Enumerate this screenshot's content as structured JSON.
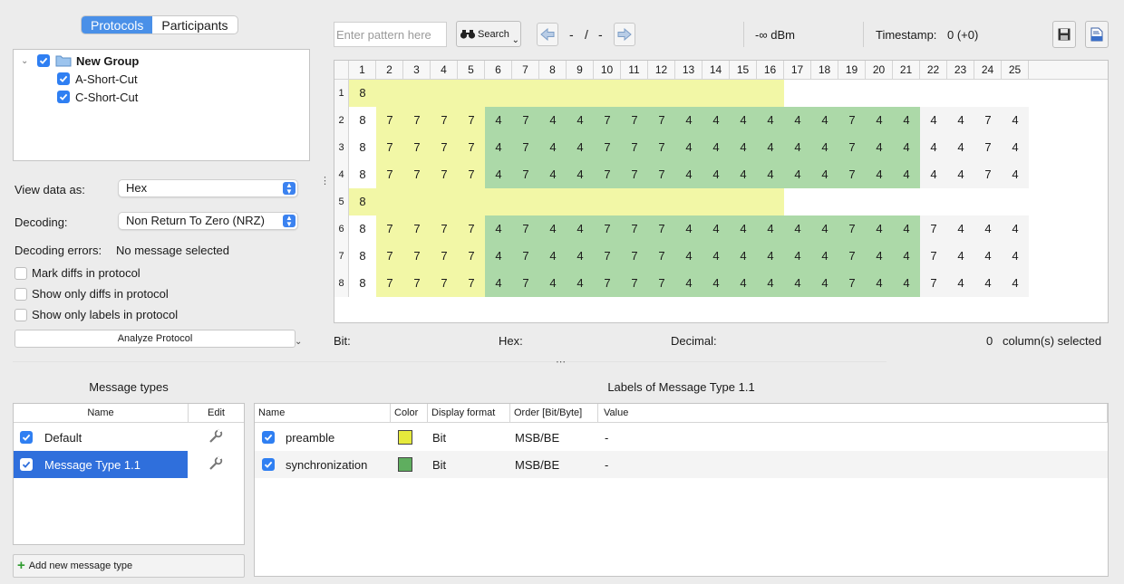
{
  "tabs": [
    {
      "label": "Protocols",
      "active": true
    },
    {
      "label": "Participants",
      "active": false
    }
  ],
  "tree": {
    "group": {
      "label": "New Group",
      "checked": true
    },
    "items": [
      {
        "label": "A-Short-Cut",
        "checked": true
      },
      {
        "label": "C-Short-Cut",
        "checked": true
      }
    ]
  },
  "settings": {
    "view_label": "View data as:",
    "view_value": "Hex",
    "decoding_label": "Decoding:",
    "decoding_value": "Non Return To Zero (NRZ)",
    "errors_label": "Decoding errors:",
    "errors_value": "No message selected",
    "options": [
      {
        "label": "Mark diffs in protocol",
        "checked": false
      },
      {
        "label": "Show only diffs in protocol",
        "checked": false
      },
      {
        "label": "Show only labels in protocol",
        "checked": false
      }
    ],
    "analyze_label": "Analyze Protocol"
  },
  "toolbar": {
    "search_placeholder": "Enter pattern here",
    "search_label": "Search",
    "result_index": "-",
    "result_sep": "/",
    "result_total": "-",
    "rssi": "-∞ dBm",
    "timestamp_label": "Timestamp:",
    "timestamp_value": "0 (+0)"
  },
  "protocol_table": {
    "columns": [
      "1",
      "2",
      "3",
      "4",
      "5",
      "6",
      "7",
      "8",
      "9",
      "10",
      "11",
      "12",
      "13",
      "14",
      "15",
      "16",
      "17",
      "18",
      "19",
      "20",
      "21",
      "22",
      "23",
      "24",
      "25"
    ],
    "rows": [
      {
        "label": "1",
        "cells": [
          "8"
        ]
      },
      {
        "label": "2",
        "cells": [
          "8",
          "7",
          "7",
          "7",
          "7",
          "4",
          "7",
          "4",
          "4",
          "7",
          "7",
          "7",
          "4",
          "4",
          "4",
          "4",
          "4",
          "4",
          "7",
          "4",
          "4",
          "4",
          "4",
          "7",
          "4"
        ]
      },
      {
        "label": "3",
        "cells": [
          "8",
          "7",
          "7",
          "7",
          "7",
          "4",
          "7",
          "4",
          "4",
          "7",
          "7",
          "7",
          "4",
          "4",
          "4",
          "4",
          "4",
          "4",
          "7",
          "4",
          "4",
          "4",
          "4",
          "7",
          "4"
        ]
      },
      {
        "label": "4",
        "cells": [
          "8",
          "7",
          "7",
          "7",
          "7",
          "4",
          "7",
          "4",
          "4",
          "7",
          "7",
          "7",
          "4",
          "4",
          "4",
          "4",
          "4",
          "4",
          "7",
          "4",
          "4",
          "4",
          "4",
          "7",
          "4"
        ]
      },
      {
        "label": "5",
        "cells": [
          "8"
        ]
      },
      {
        "label": "6",
        "cells": [
          "8",
          "7",
          "7",
          "7",
          "7",
          "4",
          "7",
          "4",
          "4",
          "7",
          "7",
          "7",
          "4",
          "4",
          "4",
          "4",
          "4",
          "4",
          "7",
          "4",
          "4",
          "7",
          "4",
          "4",
          "4"
        ]
      },
      {
        "label": "7",
        "cells": [
          "8",
          "7",
          "7",
          "7",
          "7",
          "4",
          "7",
          "4",
          "4",
          "7",
          "7",
          "7",
          "4",
          "4",
          "4",
          "4",
          "4",
          "4",
          "7",
          "4",
          "4",
          "7",
          "4",
          "4",
          "4"
        ]
      },
      {
        "label": "8",
        "cells": [
          "8",
          "7",
          "7",
          "7",
          "7",
          "4",
          "7",
          "4",
          "4",
          "7",
          "7",
          "7",
          "4",
          "4",
          "4",
          "4",
          "4",
          "4",
          "7",
          "4",
          "4",
          "7",
          "4",
          "4",
          "4"
        ]
      }
    ],
    "preamble_cols": [
      2,
      5
    ],
    "sync_cols": [
      6,
      21
    ],
    "short_row_highlight_cols": [
      1,
      16
    ]
  },
  "info_bar": {
    "bit_label": "Bit:",
    "hex_label": "Hex:",
    "decimal_label": "Decimal:",
    "selected_count": "0",
    "selected_label": "column(s) selected"
  },
  "message_types": {
    "title": "Message types",
    "header_name": "Name",
    "header_edit": "Edit",
    "items": [
      {
        "name": "Default",
        "checked": true,
        "selected": false
      },
      {
        "name": "Message Type 1.1",
        "checked": true,
        "selected": true
      }
    ],
    "add_label": "Add new message type"
  },
  "labels": {
    "title": "Labels of Message Type 1.1",
    "headers": [
      "Name",
      "Color",
      "Display format",
      "Order [Bit/Byte]",
      "Value"
    ],
    "rows": [
      {
        "name": "preamble",
        "color": "#e6ea3c",
        "format": "Bit",
        "order": "MSB/BE",
        "value": "-",
        "checked": true
      },
      {
        "name": "synchronization",
        "color": "#5fae5f",
        "format": "Bit",
        "order": "MSB/BE",
        "value": "-",
        "checked": true
      }
    ]
  },
  "colors": {
    "accent": "#2f7ff2",
    "preamble_cell": "#f2f7a6",
    "sync_cell": "#acd9a8",
    "selection": "#2f6fdc"
  }
}
